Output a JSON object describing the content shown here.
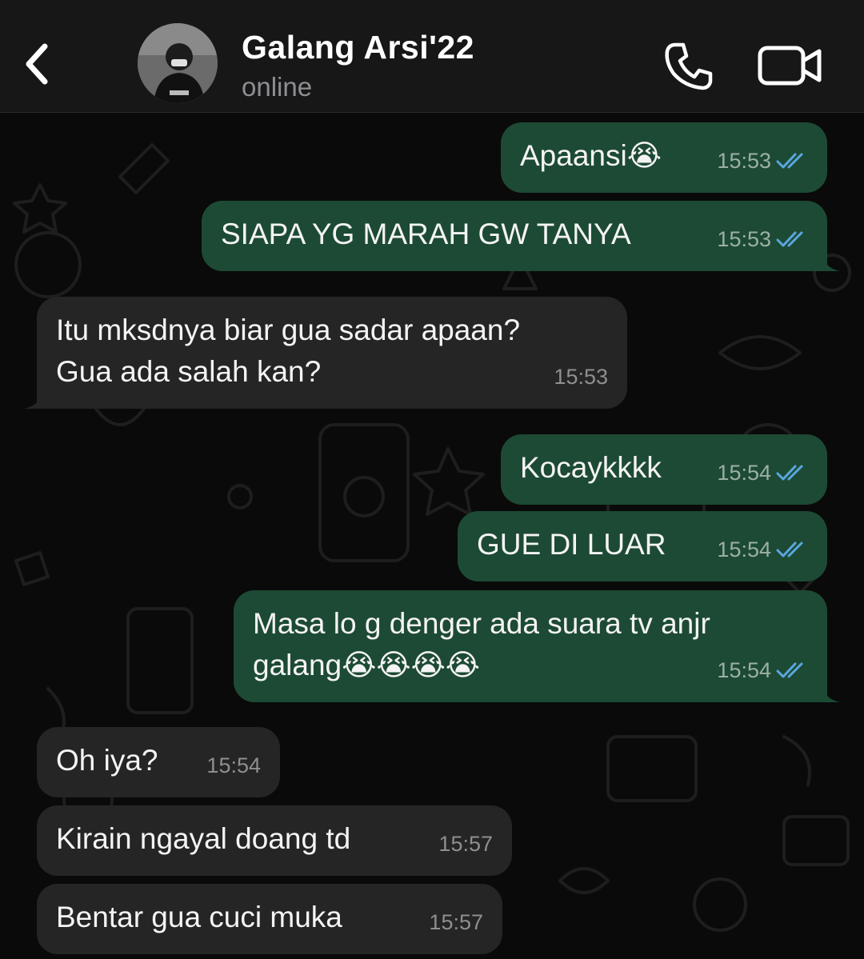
{
  "header": {
    "contact_name": "Galang Arsi'22",
    "status": "online",
    "icons": {
      "back": "chevron-left-icon",
      "call": "phone-icon",
      "video": "video-camera-icon"
    }
  },
  "colors": {
    "outgoing_bubble": "#1d4a34",
    "incoming_bubble": "#252525",
    "read_ticks": "#5aa7e0"
  },
  "messages": [
    {
      "direction": "out",
      "text": "Apaansi😭",
      "time": "15:53",
      "read": true
    },
    {
      "direction": "out",
      "text": "SIAPA YG MARAH GW TANYA",
      "time": "15:53",
      "read": true
    },
    {
      "direction": "in",
      "text": "Itu mksdnya biar gua sadar apaan?\nGua ada salah kan?",
      "time": "15:53"
    },
    {
      "direction": "out",
      "text": "Kocaykkkk",
      "time": "15:54",
      "read": true
    },
    {
      "direction": "out",
      "text": "GUE DI LUAR",
      "time": "15:54",
      "read": true
    },
    {
      "direction": "out",
      "text": "Masa lo g denger ada suara tv anjr\ngalang😭😭😭😭",
      "time": "15:54",
      "read": true
    },
    {
      "direction": "in",
      "text": "Oh iya?",
      "time": "15:54"
    },
    {
      "direction": "in",
      "text": "Kirain ngayal doang td",
      "time": "15:57"
    },
    {
      "direction": "in",
      "text": "Bentar gua cuci muka",
      "time": "15:57"
    }
  ]
}
